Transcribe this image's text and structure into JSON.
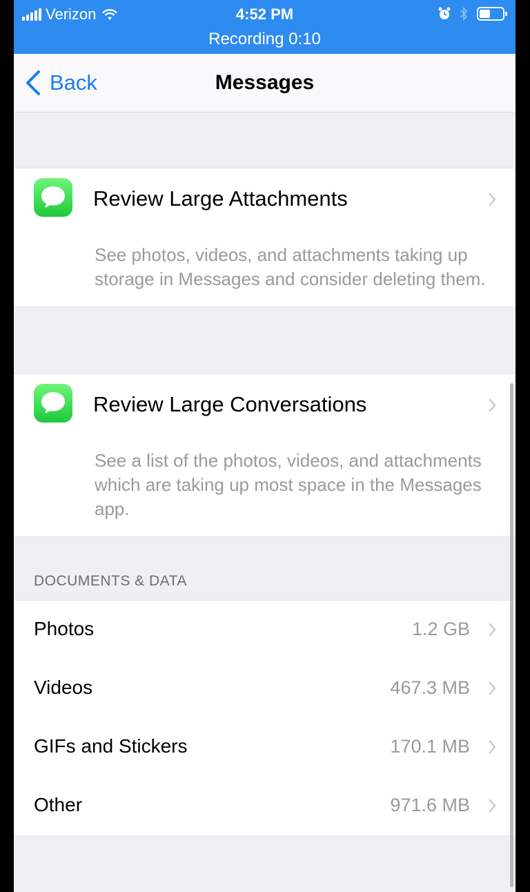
{
  "status_bar": {
    "carrier": "Verizon",
    "time": "4:52 PM",
    "recording": "Recording  0:10",
    "icons": [
      "signal-icon",
      "wifi-icon",
      "alarm-icon",
      "bluetooth-icon",
      "battery-icon"
    ]
  },
  "nav": {
    "back_label": "Back",
    "title": "Messages"
  },
  "cards": [
    {
      "title": "Review Large Attachments",
      "description": "See photos, videos, and attachments taking up storage in Messages and consider deleting them."
    },
    {
      "title": "Review Large Conversations",
      "description": "See a list of the photos, videos, and attachments which are taking up most space in the Messages app."
    }
  ],
  "documents": {
    "header": "DOCUMENTS & DATA",
    "rows": [
      {
        "label": "Photos",
        "value": "1.2 GB"
      },
      {
        "label": "Videos",
        "value": "467.3 MB"
      },
      {
        "label": "GIFs and Stickers",
        "value": "170.1 MB"
      },
      {
        "label": "Other",
        "value": "971.6 MB"
      }
    ]
  },
  "colors": {
    "status_bar": "#2e8bf0",
    "accent": "#1a7cf5",
    "messages_icon": "#34c759"
  }
}
